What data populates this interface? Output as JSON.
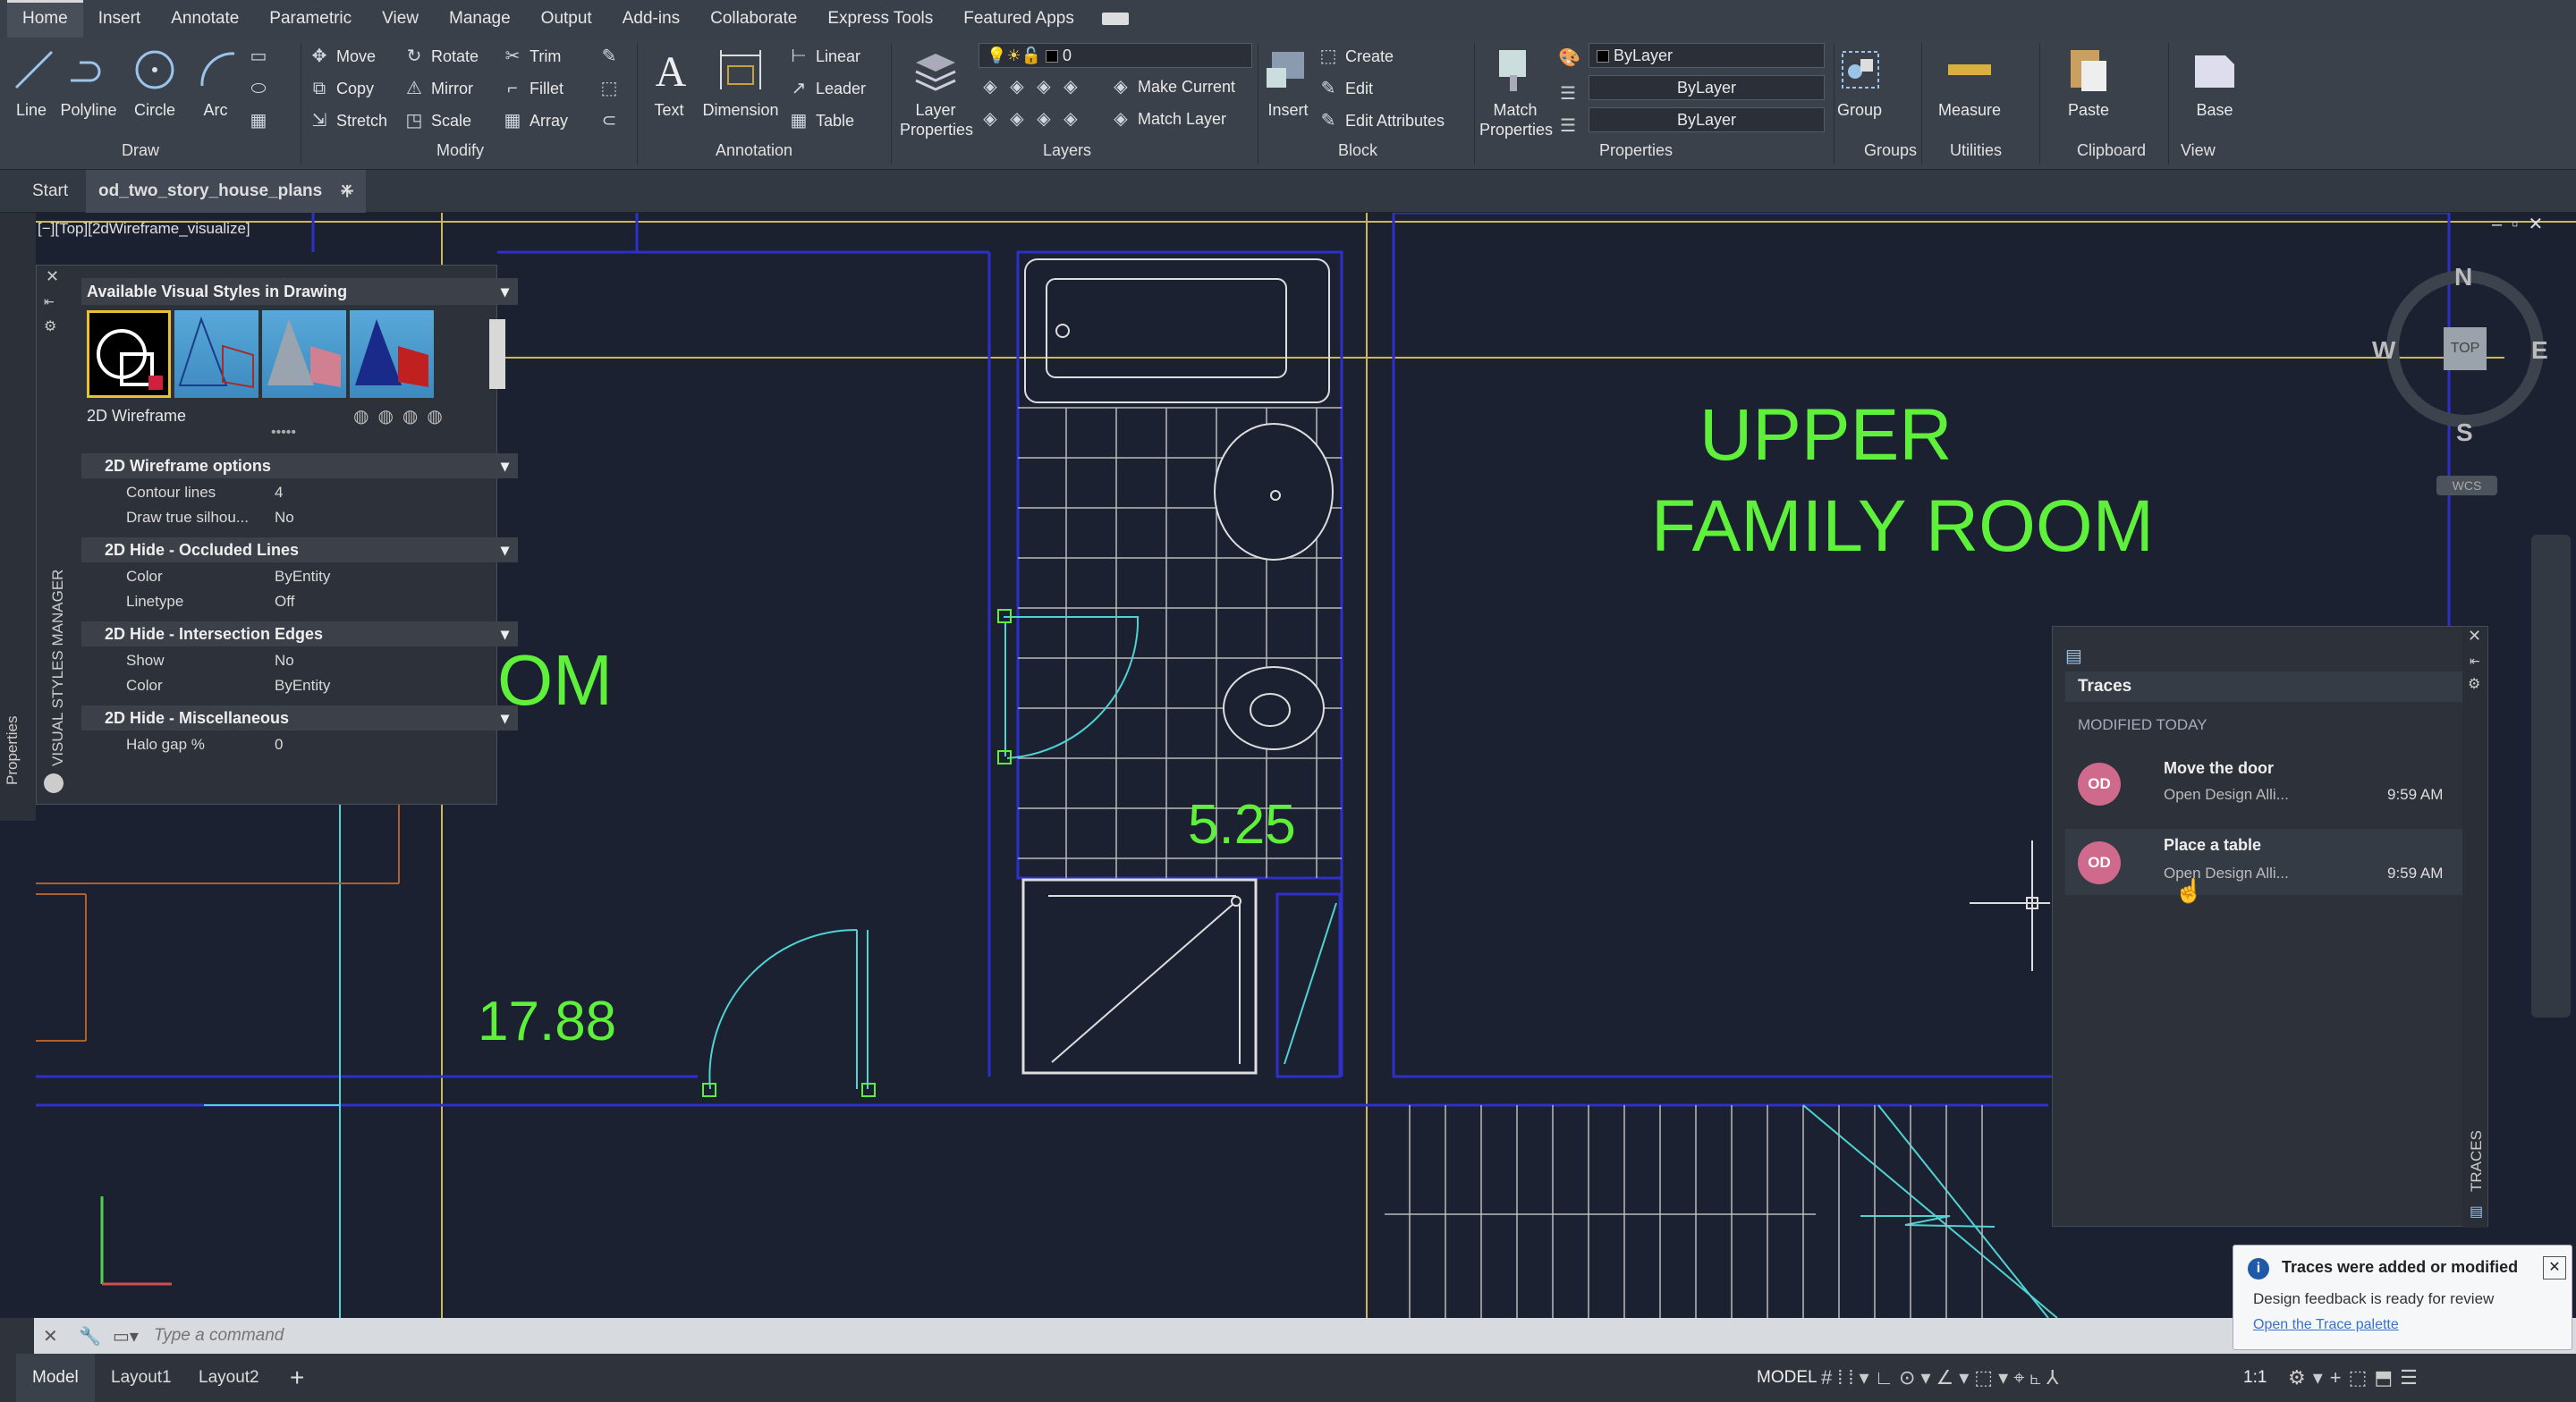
{
  "menu": {
    "tabs": [
      "Home",
      "Insert",
      "Annotate",
      "Parametric",
      "View",
      "Manage",
      "Output",
      "Add-ins",
      "Collaborate",
      "Express Tools",
      "Featured Apps"
    ]
  },
  "ribbon": {
    "draw": {
      "line": "Line",
      "polyline": "Polyline",
      "circle": "Circle",
      "arc": "Arc",
      "title": "Draw"
    },
    "modify": {
      "move": "Move",
      "rotate": "Rotate",
      "trim": "Trim",
      "copy": "Copy",
      "mirror": "Mirror",
      "fillet": "Fillet",
      "stretch": "Stretch",
      "scale": "Scale",
      "array": "Array",
      "title": "Modify"
    },
    "annotation": {
      "text": "Text",
      "dimension": "Dimension",
      "linear": "Linear",
      "leader": "Leader",
      "table": "Table",
      "title": "Annotation"
    },
    "layers": {
      "layer_properties": "Layer Properties",
      "layer_value": "0",
      "make_current": "Make Current",
      "match_layer": "Match Layer",
      "title": "Layers"
    },
    "block": {
      "insert": "Insert",
      "create": "Create",
      "edit": "Edit",
      "edit_attributes": "Edit Attributes",
      "title": "Block"
    },
    "properties": {
      "match_properties": "Match Properties",
      "color": "ByLayer",
      "linetype": "ByLayer",
      "lineweight": "ByLayer",
      "title": "Properties"
    },
    "groups": {
      "group": "Group",
      "title": "Groups"
    },
    "utilities": {
      "measure": "Measure",
      "title": "Utilities"
    },
    "clipboard": {
      "paste": "Paste",
      "title": "Clipboard"
    },
    "view": {
      "base": "Base",
      "title": "View"
    }
  },
  "doctabs": {
    "start": "Start",
    "file": "od_two_story_house_plans"
  },
  "viewport_label": "[−][Top][2dWireframe_visualize]",
  "drawing": {
    "room_label_line1": "UPPER",
    "room_label_line2": "FAMILY ROOM",
    "partial_label": "OM",
    "dim1": "5.25",
    "dim2": "17.88"
  },
  "viewcube": {
    "n": "N",
    "s": "S",
    "w": "W",
    "e": "E",
    "top": "TOP",
    "wcs": "WCS"
  },
  "vsm": {
    "side_title": "VISUAL STYLES MANAGER",
    "properties_label": "Properties",
    "header": "Available Visual Styles in Drawing",
    "current_style": "2D Wireframe",
    "sections": [
      {
        "title": "2D Wireframe options",
        "rows": [
          {
            "k": "Contour lines",
            "v": "4"
          },
          {
            "k": "Draw true silhou...",
            "v": "No"
          }
        ]
      },
      {
        "title": "2D Hide - Occluded Lines",
        "rows": [
          {
            "k": "Color",
            "v": "ByEntity"
          },
          {
            "k": "Linetype",
            "v": "Off"
          }
        ]
      },
      {
        "title": "2D Hide - Intersection Edges",
        "rows": [
          {
            "k": "Show",
            "v": "No"
          },
          {
            "k": "Color",
            "v": "ByEntity"
          }
        ]
      },
      {
        "title": "2D Hide - Miscellaneous",
        "rows": [
          {
            "k": "Halo gap %",
            "v": "0"
          }
        ]
      }
    ]
  },
  "traces": {
    "title": "Traces",
    "side_title": "TRACES",
    "section": "MODIFIED TODAY",
    "items": [
      {
        "avatar": "OD",
        "name": "Move the door",
        "author": "Open Design Alli...",
        "time": "9:59 AM"
      },
      {
        "avatar": "OD",
        "name": "Place a table",
        "author": "Open Design Alli...",
        "time": "9:59 AM"
      }
    ]
  },
  "toast": {
    "title": "Traces were added or modified",
    "body": "Design feedback is ready for review",
    "link": "Open the Trace palette"
  },
  "command": {
    "placeholder": "Type a command"
  },
  "status": {
    "tabs": [
      "Model",
      "Layout1",
      "Layout2"
    ],
    "mode": "MODEL",
    "scale": "1:1"
  },
  "colors": {
    "accent_green": "#5ef03a",
    "avatar": "#d06a8c",
    "wall_blue": "#2e30c8",
    "cyan": "#4fd2d2",
    "yellow": "#c8b95a"
  }
}
